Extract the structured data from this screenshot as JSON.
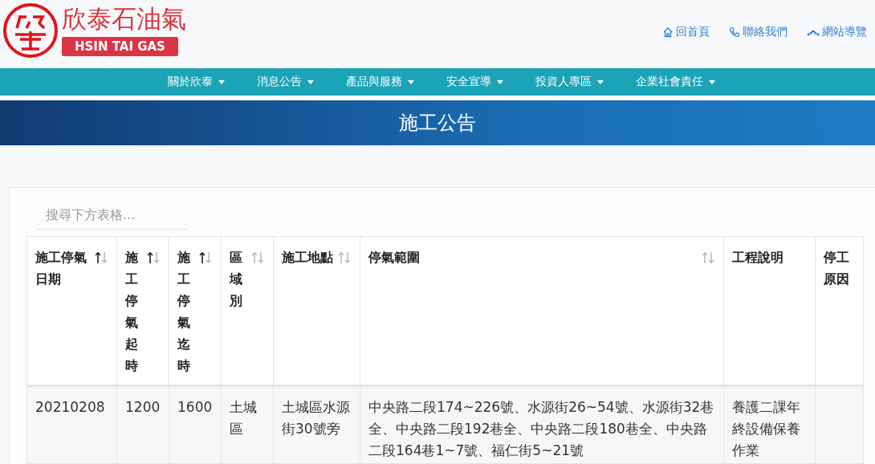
{
  "logo": {
    "name": "欣泰石油氣",
    "tagline": "HSIN TAI GAS"
  },
  "top_links": [
    {
      "label": "回首頁"
    },
    {
      "label": "聯絡我們"
    },
    {
      "label": "網站導覽"
    }
  ],
  "nav": [
    {
      "label": "關於欣泰"
    },
    {
      "label": "消息公告"
    },
    {
      "label": "產品與服務"
    },
    {
      "label": "安全宣導"
    },
    {
      "label": "投資人專區"
    },
    {
      "label": "企業社會責任"
    }
  ],
  "page_title": "施工公告",
  "search": {
    "placeholder": "搜尋下方表格..."
  },
  "table": {
    "columns": [
      {
        "label": "施工停氣日期",
        "kind": "sortable",
        "sorted": true
      },
      {
        "label": "施工停氣起時",
        "kind": "sortable",
        "sorted": true
      },
      {
        "label": "施工停氣迄時",
        "kind": "sortable",
        "sorted": true
      },
      {
        "label": "區域別",
        "kind": "sortable",
        "sorted": false
      },
      {
        "label": "施工地點",
        "kind": "sortable",
        "sorted": false
      },
      {
        "label": "停氣範圍",
        "kind": "sortable",
        "sorted": false
      },
      {
        "label": "工程說明",
        "kind": "plain"
      },
      {
        "label": "停工原因",
        "kind": "plain"
      }
    ],
    "rows": [
      [
        "20210208",
        "1200",
        "1600",
        "土城區",
        "土城區水源街30號旁",
        "中央路二段174~226號、水源街26~54號、水源街32巷全、中央路二段192巷全、中央路二段180巷全、中央路二段164巷1~7號、福仁街5~21號",
        "養護二課年終設備保養作業",
        ""
      ]
    ]
  }
}
